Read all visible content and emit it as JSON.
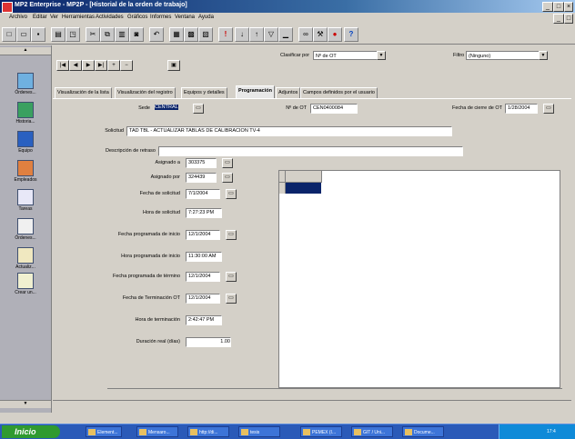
{
  "window": {
    "title": "MP2 Enterprise - MP2P - [Historial de la orden de trabajo]"
  },
  "menu": [
    "Archivo",
    "Editar",
    "Ver",
    "Herramientas",
    "Actividades",
    "Gráficos",
    "Informes",
    "Ventana",
    "Ayuda"
  ],
  "nav": {
    "sort_label": "Clasificar por",
    "sort_value": "Nº de OT",
    "filter_label": "Filtro",
    "filter_value": "(Ninguno)"
  },
  "sidebar": {
    "items": [
      {
        "label": "Órdenes..."
      },
      {
        "label": "Historia..."
      },
      {
        "label": "Equipo"
      },
      {
        "label": "Empleados"
      },
      {
        "label": "Tareas"
      },
      {
        "label": "Órdenes..."
      },
      {
        "label": "Actualiz..."
      },
      {
        "label": "Crear un..."
      }
    ]
  },
  "tabs": [
    {
      "label": "Visualización de la lista"
    },
    {
      "label": "Visualización del registro"
    },
    {
      "label": "Equipos y detalles"
    },
    {
      "label": "Programación"
    },
    {
      "label": "Adjuntos"
    },
    {
      "label": "Campos definidos por el usuario"
    }
  ],
  "form": {
    "sede_label": "Sede",
    "sede_value": "CENTRAL",
    "ot_label": "Nº de OT",
    "ot_value": "CEN0400084",
    "cierre_label": "Fecha de cierre de OT",
    "cierre_value": "1/28/2004",
    "solicitud_label": "Solicitud",
    "solicitud_value": "TAD TBL - ACTUALIZAR TABLAS DE CALIBRACION TV-4",
    "retraso_label": "Descripción de retraso",
    "retraso_value": "",
    "rows": [
      {
        "label": "Asignado a",
        "value": "303375"
      },
      {
        "label": "Asignado por",
        "value": "324439"
      },
      {
        "label": "Fecha de solicitud",
        "value": "7/1/2004"
      },
      {
        "label": "Hora de solicitud",
        "value": "7:27:23 PM"
      },
      {
        "label": "Fecha programada de inicio",
        "value": "12/1/2004"
      },
      {
        "label": "Hora programada de inicio",
        "value": "11:30:00 AM"
      },
      {
        "label": "Fecha programada de término",
        "value": "12/1/2004"
      },
      {
        "label": "Fecha de Terminación OT",
        "value": "12/1/2004"
      },
      {
        "label": "Hora de terminación",
        "value": "2:42:47 PM"
      },
      {
        "label": "Duración real (días)",
        "value": "1.00"
      }
    ]
  },
  "taskbar": {
    "start_label": "Inicio",
    "tasks": [
      "Element...",
      "Mensaro...",
      "http://di...",
      "tesis",
      "PEMEX (I...",
      "GIT / Uni...",
      "Docume..."
    ],
    "clock": "17:4"
  }
}
